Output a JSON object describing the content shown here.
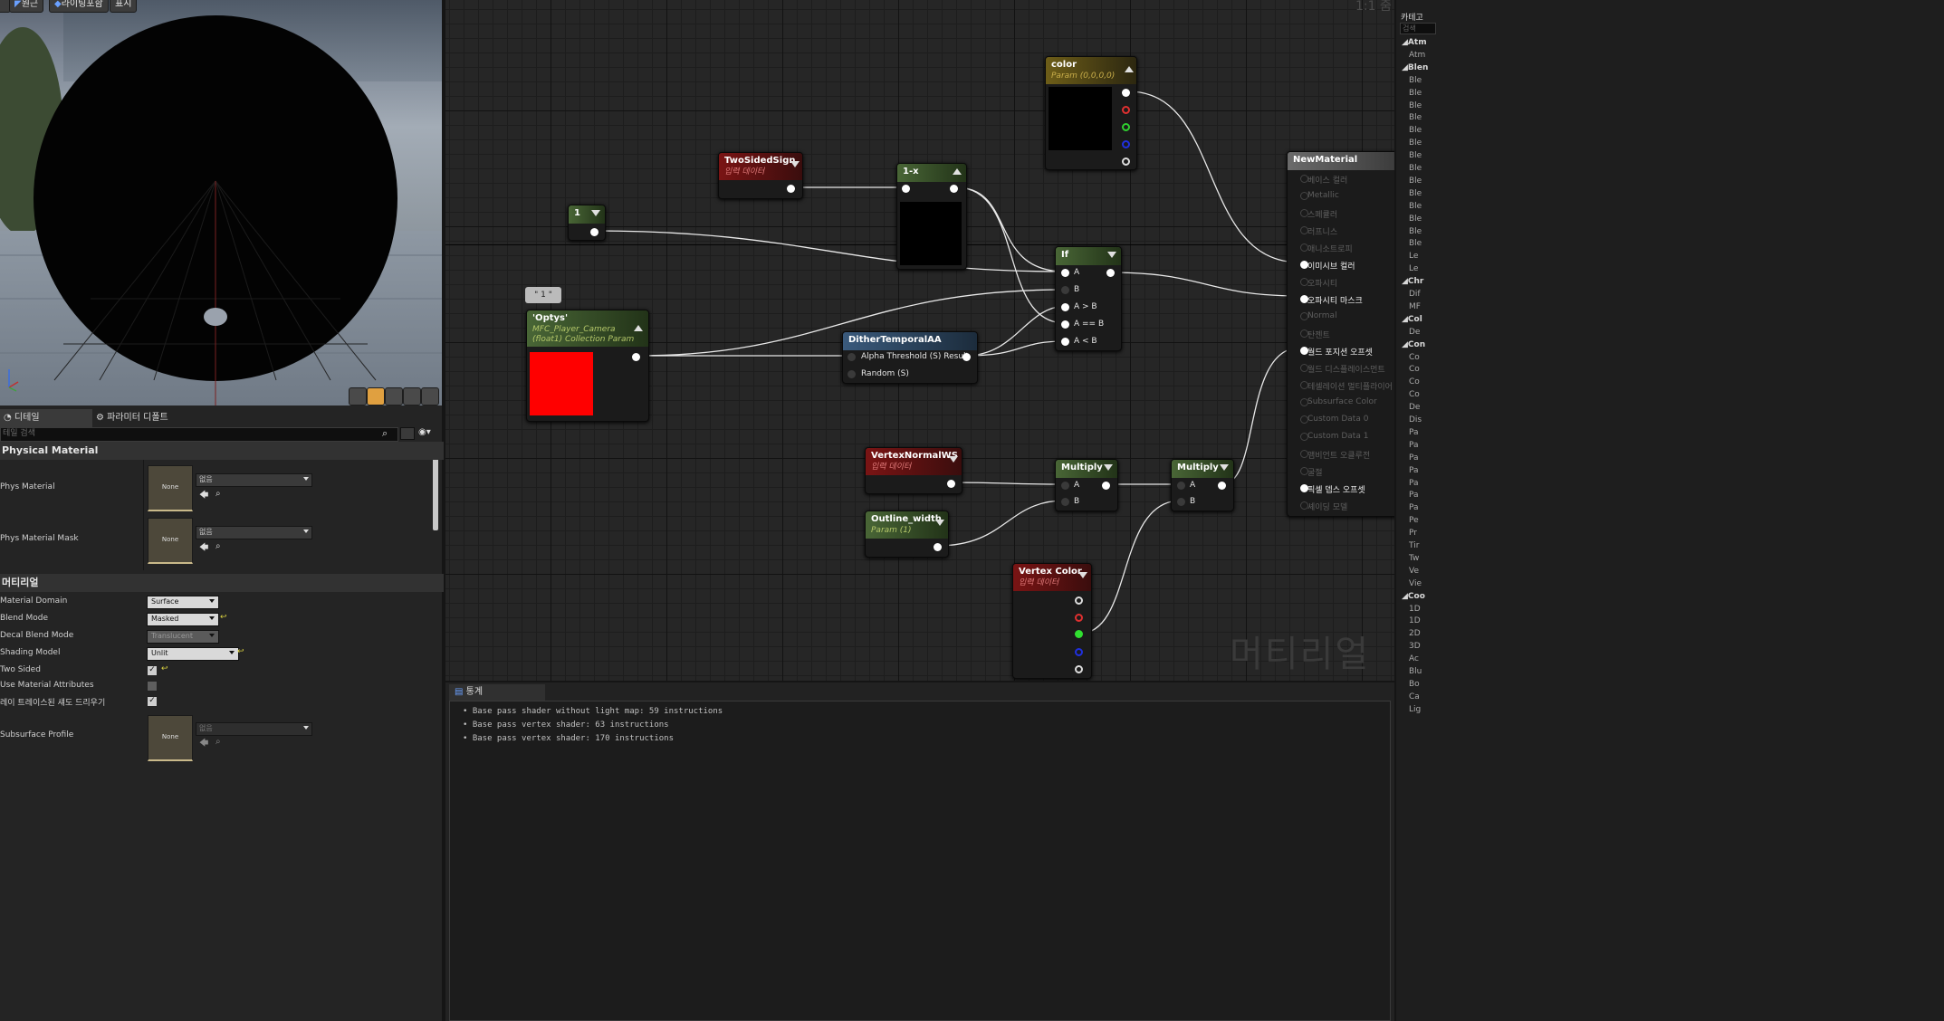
{
  "viewport": {
    "toolbar": {
      "perspective": "원근",
      "lighting": "라이팅포함",
      "show": "표시"
    }
  },
  "details": {
    "tabs": [
      {
        "label": "디테일"
      },
      {
        "label": "파라미터 디폴트"
      }
    ],
    "search_placeholder": "테일 검색",
    "physical_material": {
      "header": "Physical Material",
      "phys_material_label": "Phys Material",
      "phys_material_mask_label": "Phys Material Mask",
      "none_thumb": "None",
      "none_value": "없음"
    },
    "material": {
      "header": "머티리얼",
      "rows": [
        {
          "label": "Material Domain",
          "value": "Surface"
        },
        {
          "label": "Blend Mode",
          "value": "Masked"
        },
        {
          "label": "Decal Blend Mode",
          "value": "Translucent"
        },
        {
          "label": "Shading Model",
          "value": "Unlit"
        },
        {
          "label": "Two Sided",
          "checked": true
        },
        {
          "label": "Use Material Attributes",
          "checked": false
        },
        {
          "label": "레이 트레이스된 섀도 드리우기",
          "checked": true
        },
        {
          "label": "Subsurface Profile",
          "value": "없음"
        }
      ]
    }
  },
  "graph": {
    "zoom": "1:1 줌",
    "watermark": "머티리얼",
    "nodes": {
      "color": {
        "title": "color",
        "subtitle": "Param (0,0,0,0)"
      },
      "twosided": {
        "title": "TwoSidedSign",
        "subtitle": "입력 데이터"
      },
      "oneminus": {
        "title": "1-x"
      },
      "const1": {
        "title": "1"
      },
      "if": {
        "title": "If",
        "pins": [
          "A",
          "B",
          "A > B",
          "A == B",
          "A < B"
        ]
      },
      "optys_comment": "\" 1 \"",
      "optys": {
        "title": "'Optys'",
        "subtitle": "MFC_Player_Camera",
        "subtitle2": "(float1) Collection Param",
        "swatch": "#ff0000"
      },
      "dither": {
        "title": "DitherTemporalAA",
        "pins": [
          "Alpha Threshold (S) Result",
          "Random (S)"
        ]
      },
      "vnormal": {
        "title": "VertexNormalWS",
        "subtitle": "입력 데이터"
      },
      "outline": {
        "title": "Outline_width",
        "subtitle": "Param (1)"
      },
      "multiply1": {
        "title": "Multiply",
        "pins": [
          "A",
          "B"
        ]
      },
      "multiply2": {
        "title": "Multiply",
        "pins": [
          "A",
          "B"
        ]
      },
      "vcolor": {
        "title": "Vertex Color",
        "subtitle": "입력 데이터"
      },
      "newmat": {
        "title": "NewMaterial",
        "inputs": [
          {
            "label": "베이스 컬러",
            "on": false
          },
          {
            "label": "Metallic",
            "on": false
          },
          {
            "label": "스페큘러",
            "on": false
          },
          {
            "label": "러프니스",
            "on": false
          },
          {
            "label": "애니소트로피",
            "on": false
          },
          {
            "label": "이미시브 컬러",
            "on": true
          },
          {
            "label": "오파시티",
            "on": false
          },
          {
            "label": "오파시티 마스크",
            "on": true
          },
          {
            "label": "Normal",
            "on": false
          },
          {
            "label": "탄젠트",
            "on": false
          },
          {
            "label": "월드 포지션 오프셋",
            "on": true
          },
          {
            "label": "월드 디스플레이스먼트",
            "on": false
          },
          {
            "label": "테셀레이션 멀티플라이어",
            "on": false
          },
          {
            "label": "Subsurface Color",
            "on": false
          },
          {
            "label": "Custom Data 0",
            "on": false
          },
          {
            "label": "Custom Data 1",
            "on": false
          },
          {
            "label": "앰비언트 오클루전",
            "on": false
          },
          {
            "label": "굴절",
            "on": false
          },
          {
            "label": "픽셀 뎁스 오프셋",
            "on": true
          },
          {
            "label": "셰이딩 모델",
            "on": false
          }
        ]
      }
    }
  },
  "stats": {
    "tab": "통계",
    "lines": [
      "• Base pass shader without light map: 59 instructions",
      "• Base pass vertex shader: 63 instructions",
      "• Base pass vertex shader: 170 instructions"
    ]
  },
  "palette": {
    "header": "카테고",
    "search": "검색",
    "entries": [
      {
        "t": "cat",
        "label": "◢Atm"
      },
      {
        "t": "item",
        "label": "Atm"
      },
      {
        "t": "cat",
        "label": "◢Blen"
      },
      {
        "t": "item",
        "label": "Ble"
      },
      {
        "t": "item",
        "label": "Ble"
      },
      {
        "t": "item",
        "label": "Ble"
      },
      {
        "t": "item",
        "label": "Ble"
      },
      {
        "t": "item",
        "label": "Ble"
      },
      {
        "t": "item",
        "label": "Ble"
      },
      {
        "t": "item",
        "label": "Ble"
      },
      {
        "t": "item",
        "label": "Ble"
      },
      {
        "t": "item",
        "label": "Ble"
      },
      {
        "t": "item",
        "label": "Ble"
      },
      {
        "t": "item",
        "label": "Ble"
      },
      {
        "t": "item",
        "label": "Ble"
      },
      {
        "t": "item",
        "label": "Ble"
      },
      {
        "t": "item",
        "label": "Ble"
      },
      {
        "t": "item",
        "label": "Le"
      },
      {
        "t": "item",
        "label": "Le"
      },
      {
        "t": "cat",
        "label": "◢Chr"
      },
      {
        "t": "item",
        "label": "Dif"
      },
      {
        "t": "item",
        "label": "MF"
      },
      {
        "t": "cat",
        "label": "◢Col"
      },
      {
        "t": "item",
        "label": "De"
      },
      {
        "t": "cat",
        "label": "◢Con"
      },
      {
        "t": "item",
        "label": "Co"
      },
      {
        "t": "item",
        "label": "Co"
      },
      {
        "t": "item",
        "label": "Co"
      },
      {
        "t": "item",
        "label": "Co"
      },
      {
        "t": "item",
        "label": "De"
      },
      {
        "t": "item",
        "label": "Dis"
      },
      {
        "t": "item",
        "label": "Pa"
      },
      {
        "t": "item",
        "label": "Pa"
      },
      {
        "t": "item",
        "label": "Pa"
      },
      {
        "t": "item",
        "label": "Pa"
      },
      {
        "t": "item",
        "label": "Pa"
      },
      {
        "t": "item",
        "label": "Pa"
      },
      {
        "t": "item",
        "label": "Pa"
      },
      {
        "t": "item",
        "label": "Pe"
      },
      {
        "t": "item",
        "label": "Pr"
      },
      {
        "t": "item",
        "label": "Tir"
      },
      {
        "t": "item",
        "label": "Tw"
      },
      {
        "t": "item",
        "label": "Ve"
      },
      {
        "t": "item",
        "label": "Vie"
      },
      {
        "t": "cat",
        "label": "◢Coo"
      },
      {
        "t": "item",
        "label": "1D"
      },
      {
        "t": "item",
        "label": "1D"
      },
      {
        "t": "item",
        "label": "2D"
      },
      {
        "t": "item",
        "label": "3D"
      },
      {
        "t": "item",
        "label": "Ac"
      },
      {
        "t": "item",
        "label": "Blu"
      },
      {
        "t": "item",
        "label": "Bo"
      },
      {
        "t": "item",
        "label": "Ca"
      },
      {
        "t": "item",
        "label": "Lig"
      }
    ]
  }
}
